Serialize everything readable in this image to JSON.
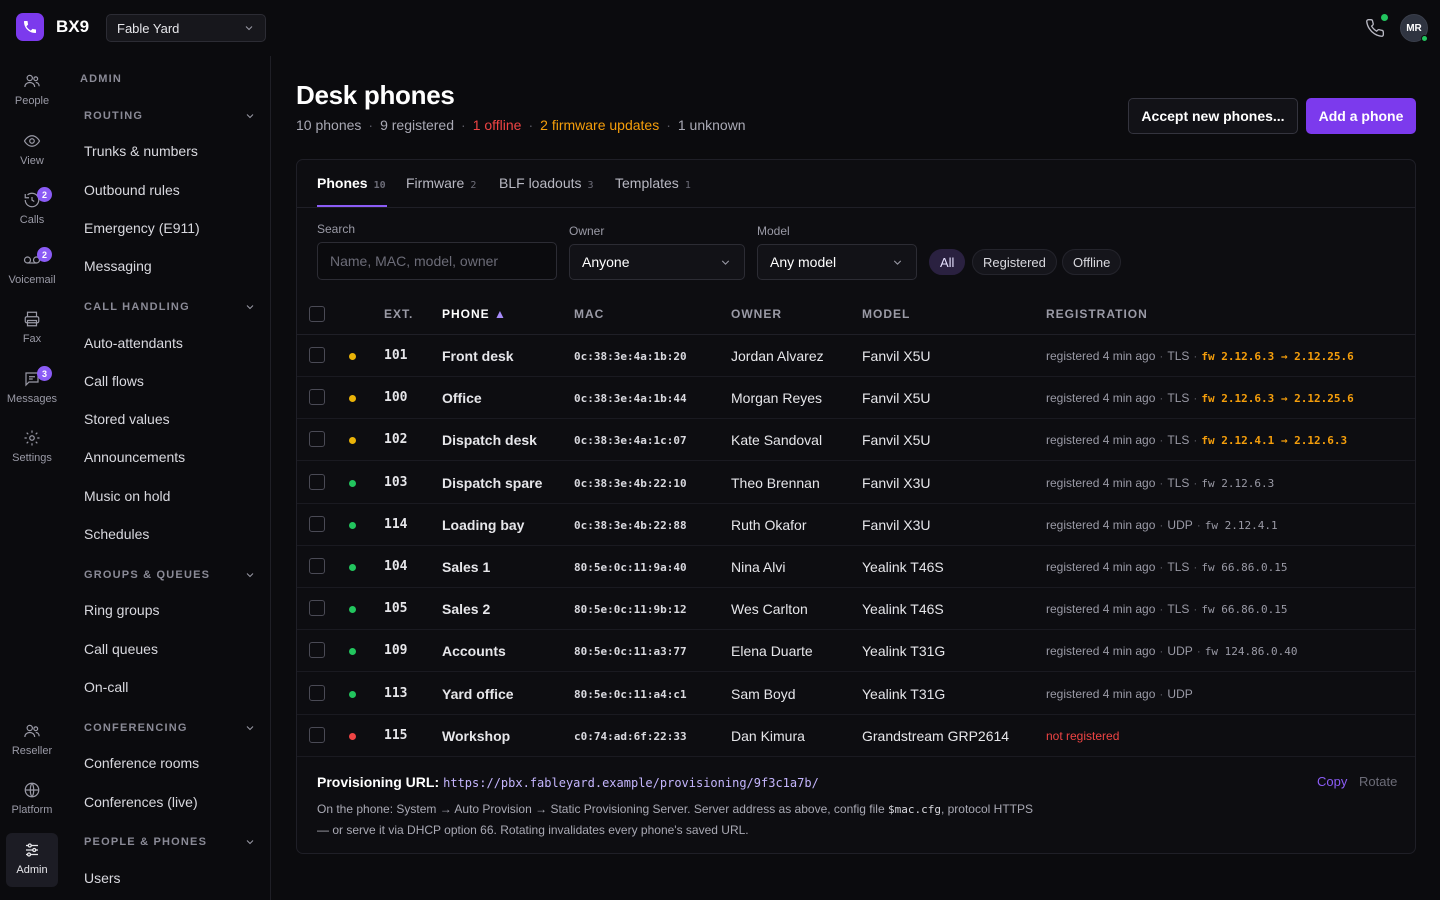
{
  "app": {
    "brand": "BX9",
    "workspace": "Fable Yard",
    "user_initials": "MR"
  },
  "rail": [
    {
      "label": "People",
      "icon": "people-icon"
    },
    {
      "label": "View",
      "icon": "eye-icon"
    },
    {
      "label": "Calls",
      "icon": "calls-icon",
      "badge": "2"
    },
    {
      "label": "Voicemail",
      "icon": "voicemail-icon",
      "badge": "2"
    },
    {
      "label": "Fax",
      "icon": "fax-icon"
    },
    {
      "label": "Messages",
      "icon": "messages-icon",
      "badge": "3"
    },
    {
      "label": "Settings",
      "icon": "settings-icon"
    },
    {
      "label": "Reseller",
      "icon": "reseller-icon"
    },
    {
      "label": "Platform",
      "icon": "globe-icon"
    },
    {
      "label": "Admin",
      "icon": "sliders-icon"
    }
  ],
  "sidebar": {
    "section": "ADMIN",
    "groups": [
      {
        "title": "ROUTING",
        "items": [
          "Trunks & numbers",
          "Outbound rules",
          "Emergency (E911)",
          "Messaging"
        ]
      },
      {
        "title": "CALL HANDLING",
        "items": [
          "Auto-attendants",
          "Call flows",
          "Stored values",
          "Announcements",
          "Music on hold",
          "Schedules"
        ]
      },
      {
        "title": "GROUPS & QUEUES",
        "items": [
          "Ring groups",
          "Call queues",
          "On-call"
        ]
      },
      {
        "title": "CONFERENCING",
        "items": [
          "Conference rooms",
          "Conferences (live)"
        ]
      },
      {
        "title": "PEOPLE & PHONES",
        "items": [
          "Users"
        ]
      }
    ]
  },
  "page": {
    "title": "Desk phones",
    "summary": {
      "phones": "10 phones",
      "registered": "9 registered",
      "offline": "1 offline",
      "firmware": "2 firmware updates",
      "unknown": "1 unknown"
    },
    "accept_button": "Accept new phones...",
    "add_button": "Add a phone"
  },
  "tabs": [
    {
      "label": "Phones",
      "count": "10"
    },
    {
      "label": "Firmware",
      "count": "2"
    },
    {
      "label": "BLF loadouts",
      "count": "3"
    },
    {
      "label": "Templates",
      "count": "1"
    }
  ],
  "filters": {
    "search_label": "Search",
    "search_placeholder": "Name, MAC, model, owner",
    "owner_label": "Owner",
    "owner_value": "Anyone",
    "model_label": "Model",
    "model_value": "Any model",
    "chips": [
      "All",
      "Registered",
      "Offline"
    ]
  },
  "table": {
    "headers": {
      "ext": "EXT.",
      "phone": "PHONE",
      "mac": "MAC",
      "owner": "OWNER",
      "model": "MODEL",
      "registration": "REGISTRATION"
    },
    "rows": [
      {
        "status": "warn",
        "ext": "101",
        "phone": "Front desk",
        "mac": "0c:38:3e:4a:1b:20",
        "owner": "Jordan Alvarez",
        "model": "Fanvil X5U",
        "reg": "registered 4 min ago",
        "transport": "TLS",
        "fw": "fw 2.12.6.3 → 2.12.25.6",
        "fw_update": true
      },
      {
        "status": "warn",
        "ext": "100",
        "phone": "Office",
        "mac": "0c:38:3e:4a:1b:44",
        "owner": "Morgan Reyes",
        "model": "Fanvil X5U",
        "reg": "registered 4 min ago",
        "transport": "TLS",
        "fw": "fw 2.12.6.3 → 2.12.25.6",
        "fw_update": true
      },
      {
        "status": "warn",
        "ext": "102",
        "phone": "Dispatch desk",
        "mac": "0c:38:3e:4a:1c:07",
        "owner": "Kate Sandoval",
        "model": "Fanvil X5U",
        "reg": "registered 4 min ago",
        "transport": "TLS",
        "fw": "fw 2.12.4.1 → 2.12.6.3",
        "fw_update": true
      },
      {
        "status": "ok",
        "ext": "103",
        "phone": "Dispatch spare",
        "mac": "0c:38:3e:4b:22:10",
        "owner": "Theo Brennan",
        "model": "Fanvil X3U",
        "reg": "registered 4 min ago",
        "transport": "TLS",
        "fw": "fw 2.12.6.3",
        "fw_update": false
      },
      {
        "status": "ok",
        "ext": "114",
        "phone": "Loading bay",
        "mac": "0c:38:3e:4b:22:88",
        "owner": "Ruth Okafor",
        "model": "Fanvil X3U",
        "reg": "registered 4 min ago",
        "transport": "UDP",
        "fw": "fw 2.12.4.1",
        "fw_update": false
      },
      {
        "status": "ok",
        "ext": "104",
        "phone": "Sales 1",
        "mac": "80:5e:0c:11:9a:40",
        "owner": "Nina Alvi",
        "model": "Yealink T46S",
        "reg": "registered 4 min ago",
        "transport": "TLS",
        "fw": "fw 66.86.0.15",
        "fw_update": false
      },
      {
        "status": "ok",
        "ext": "105",
        "phone": "Sales 2",
        "mac": "80:5e:0c:11:9b:12",
        "owner": "Wes Carlton",
        "model": "Yealink T46S",
        "reg": "registered 4 min ago",
        "transport": "TLS",
        "fw": "fw 66.86.0.15",
        "fw_update": false
      },
      {
        "status": "ok",
        "ext": "109",
        "phone": "Accounts",
        "mac": "80:5e:0c:11:a3:77",
        "owner": "Elena Duarte",
        "model": "Yealink T31G",
        "reg": "registered 4 min ago",
        "transport": "UDP",
        "fw": "fw 124.86.0.40",
        "fw_update": false
      },
      {
        "status": "ok",
        "ext": "113",
        "phone": "Yard office",
        "mac": "80:5e:0c:11:a4:c1",
        "owner": "Sam Boyd",
        "model": "Yealink T31G",
        "reg": "registered 4 min ago",
        "transport": "UDP",
        "fw": "",
        "fw_update": false
      },
      {
        "status": "bad",
        "ext": "115",
        "phone": "Workshop",
        "mac": "c0:74:ad:6f:22:33",
        "owner": "Dan Kimura",
        "model": "Grandstream GRP2614",
        "reg": "not registered",
        "transport": "",
        "fw": "",
        "fw_update": false
      }
    ]
  },
  "provisioning": {
    "label": "Provisioning URL:",
    "url": "https://pbx.fableyard.example/provisioning/9f3c1a7b/",
    "desc_1": "On the phone: System → Auto Provision → Static Provisioning Server. Server address as above, config file",
    "desc_code": "$mac.cfg",
    "desc_2": ", protocol HTTPS",
    "desc_3": "— or serve it via DHCP option 66. Rotating invalidates every phone's saved URL.",
    "copy": "Copy",
    "rotate": "Rotate"
  },
  "colors": {
    "accent": "#7c3aed",
    "ok": "#22c55e",
    "warn": "#eab308",
    "bad": "#ef4444",
    "fw_update": "#f59e0b"
  }
}
